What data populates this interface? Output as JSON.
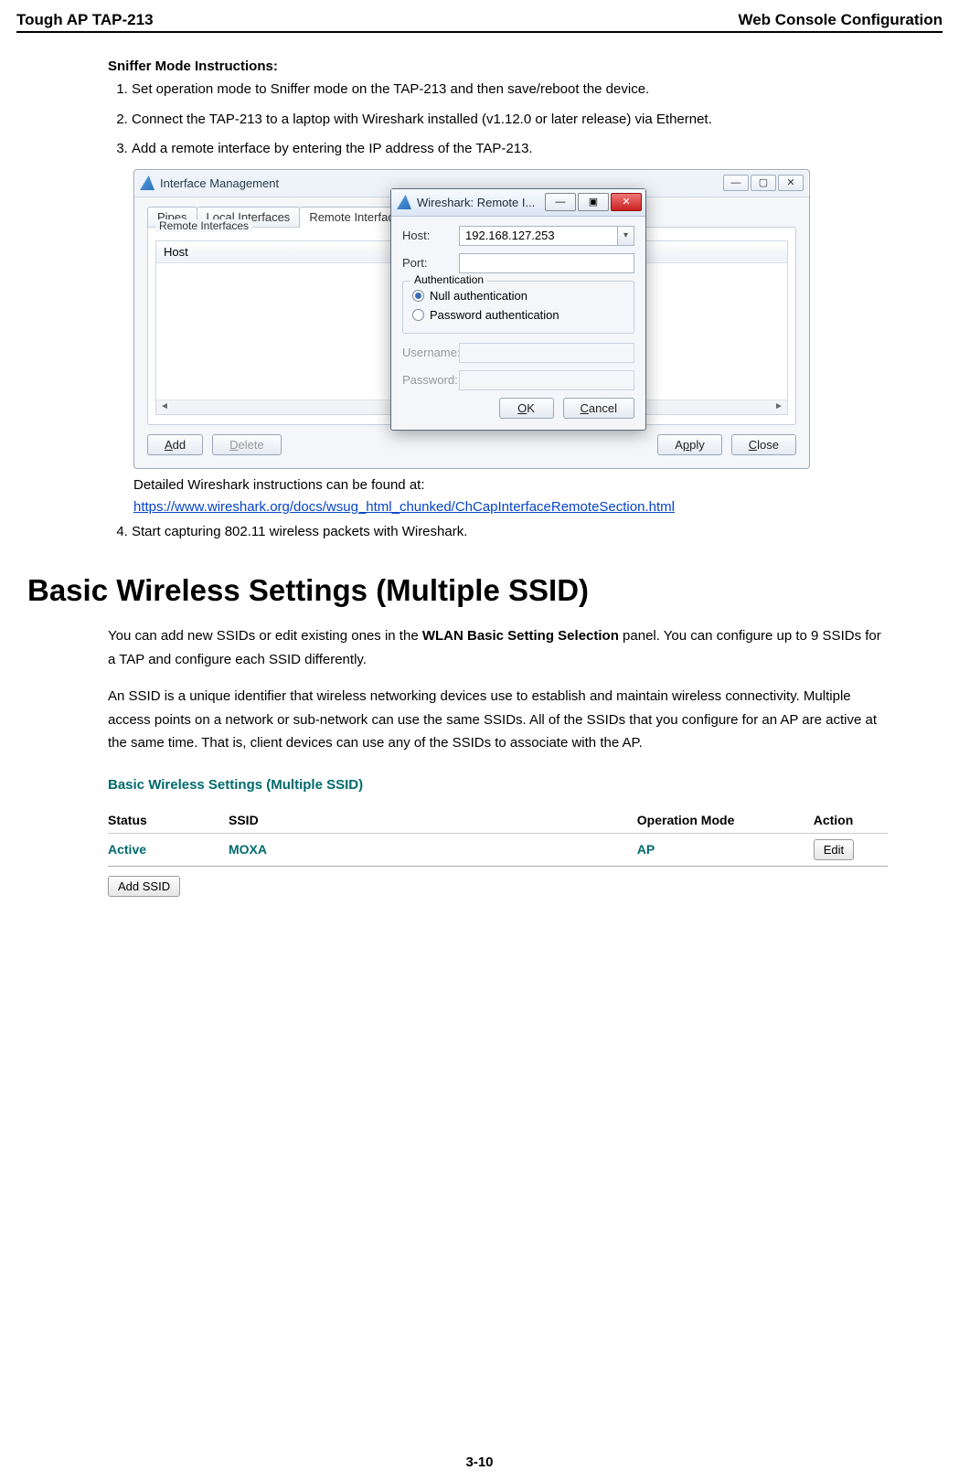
{
  "header": {
    "left": "Tough AP TAP-213",
    "right": "Web Console Configuration"
  },
  "sniffer": {
    "heading": "Sniffer Mode Instructions:",
    "steps": [
      "Set operation mode to Sniffer mode on the TAP-213 and then save/reboot the device.",
      "Connect the TAP-213 to a laptop with Wireshark installed (v1.12.0 or later release) via Ethernet.",
      "Add a remote interface by entering the IP address of the TAP-213."
    ],
    "step4": "Start capturing 802.11 wireless packets with Wireshark.",
    "caption": "Detailed Wireshark instructions can be found at:",
    "link": "https://www.wireshark.org/docs/wsug_html_chunked/ChCapInterfaceRemoteSection.html"
  },
  "win": {
    "title": "Interface Management",
    "tabs": {
      "pipes": "Pipes",
      "local": "Local Interfaces",
      "remote": "Remote Interfaces"
    },
    "group": "Remote Interfaces",
    "hostcol": "Host",
    "btn_add": "Add",
    "btn_delete": "Delete",
    "btn_apply": "Apply",
    "btn_close": "Close",
    "min": "—",
    "max": "▢",
    "x": "✕"
  },
  "dialog": {
    "title": "Wireshark: Remote I...",
    "host_label": "Host:",
    "host_value": "192.168.127.253",
    "port_label": "Port:",
    "port_value": "",
    "auth_group": "Authentication",
    "null_auth": "Null authentication",
    "pwd_auth": "Password authentication",
    "user_label": "Username:",
    "pass_label": "Password:",
    "ok": "OK",
    "cancel": "Cancel",
    "min": "—",
    "max": "▣",
    "x": "✕"
  },
  "section": {
    "title": "Basic Wireless Settings (Multiple SSID)",
    "p1a": "You can add new SSIDs or edit existing ones in the ",
    "p1b": "WLAN Basic Setting Selection",
    "p1c": " panel. You can configure up to 9 SSIDs for a TAP and configure each SSID differently.",
    "p2": "An SSID is a unique identifier that wireless networking devices use to establish and maintain wireless connectivity. Multiple access points on a network or sub-network can use the same SSIDs. All of the SSIDs that you configure for an AP are active at the same time. That is, client devices can use any of the SSIDs to associate with the AP."
  },
  "panel": {
    "title": "Basic Wireless Settings (Multiple SSID)",
    "cols": {
      "status": "Status",
      "ssid": "SSID",
      "op": "Operation Mode",
      "action": "Action"
    },
    "row": {
      "status": "Active",
      "ssid": "MOXA",
      "op": "AP",
      "edit": "Edit"
    },
    "add_ssid": "Add SSID"
  },
  "footer": {
    "page": "3-10"
  }
}
